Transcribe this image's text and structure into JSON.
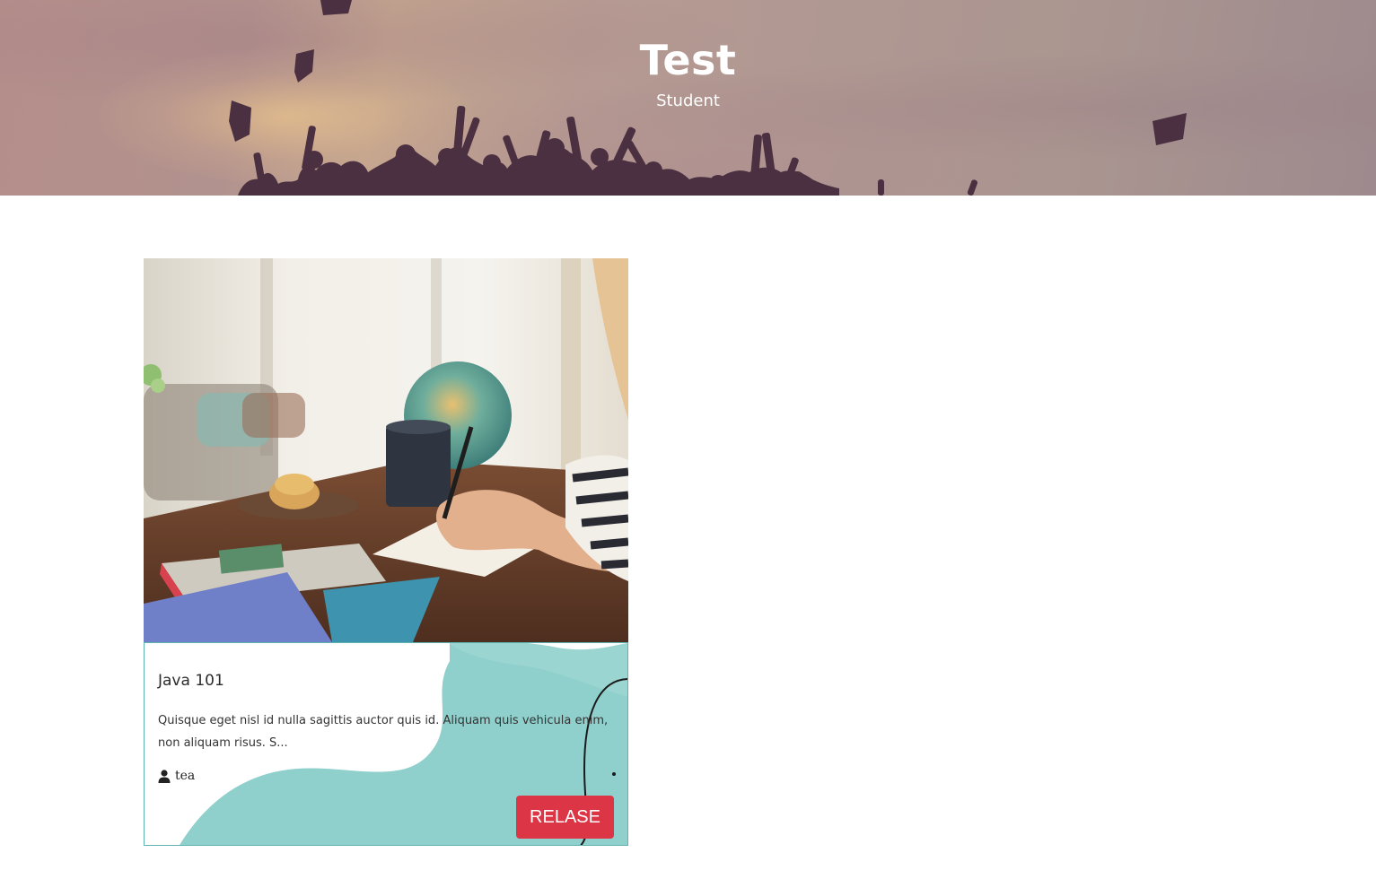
{
  "hero": {
    "title": "Test",
    "subtitle": "Student"
  },
  "card": {
    "title": "Java 101",
    "description": "Quisque eget nisl id nulla sagittis auctor quis id. Aliquam quis vehicula enim, non aliquam risus. S...",
    "author": "tea",
    "author_icon": "user-icon",
    "action_label": "RELASE"
  },
  "colors": {
    "accent_button": "#dc3545",
    "card_border": "#5fb3b3",
    "blob": "#8fd0cc"
  }
}
